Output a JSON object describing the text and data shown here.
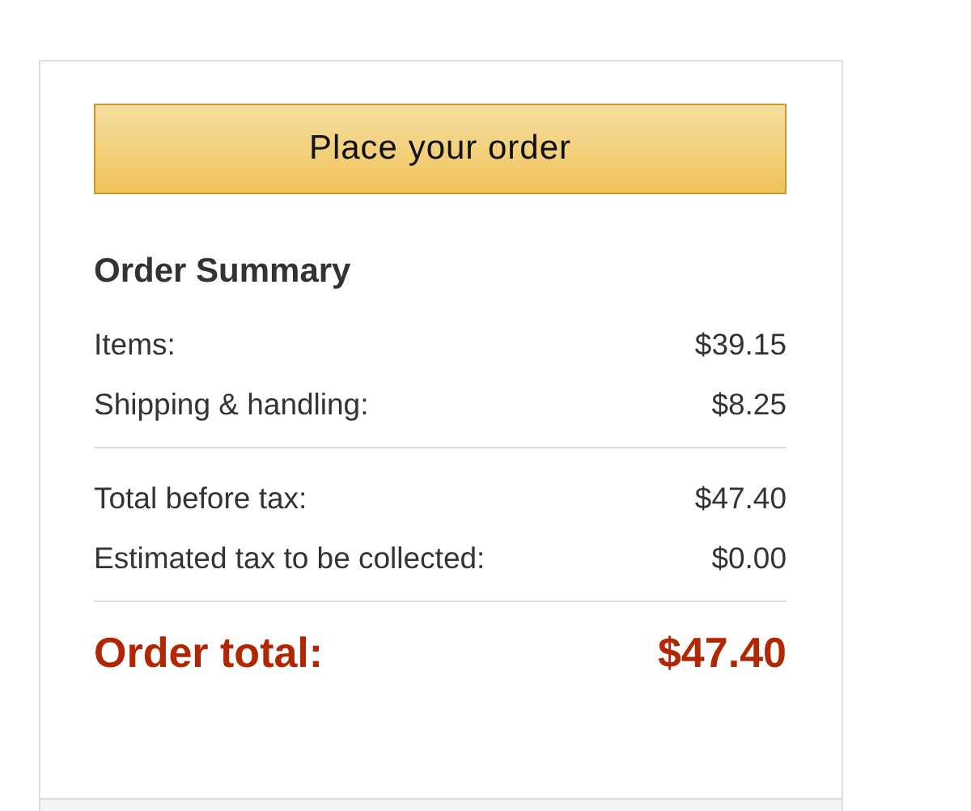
{
  "button": {
    "label": "Place your order"
  },
  "summary": {
    "title": "Order Summary",
    "groups": [
      [
        {
          "label": "Items:",
          "amount": "$39.15"
        },
        {
          "label": "Shipping & handling:",
          "amount": "$8.25"
        }
      ],
      [
        {
          "label": "Total before tax:",
          "amount": "$47.40"
        },
        {
          "label": "Estimated tax to be collected:",
          "amount": "$0.00"
        }
      ]
    ],
    "total": {
      "label": "Order total:",
      "amount": "$47.40"
    }
  }
}
